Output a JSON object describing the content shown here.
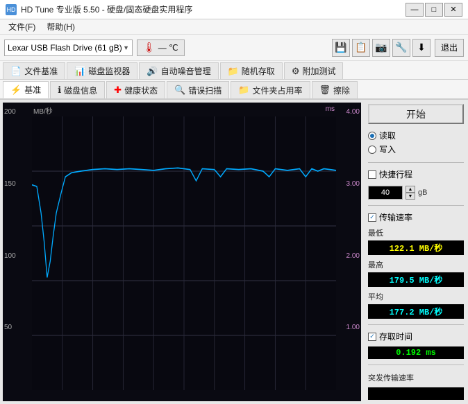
{
  "titlebar": {
    "title": "HD Tune 专业版 5.50 - 硬盘/固态硬盘实用程序",
    "icon_label": "HD",
    "min_btn": "—",
    "max_btn": "□",
    "close_btn": "✕"
  },
  "menubar": {
    "items": [
      {
        "label": "文件(F)",
        "underline": "F"
      },
      {
        "label": "帮助(H)",
        "underline": "H"
      }
    ]
  },
  "toolbar": {
    "device_name": "Lexar   USB Flash Drive (61 gB)",
    "temp_label": "— ℃",
    "icons": [
      "💾",
      "📋",
      "📷",
      "🔧",
      "⬇"
    ],
    "exit_label": "退出"
  },
  "tabs_row1": [
    {
      "label": "文件基准",
      "icon": "📄",
      "active": false
    },
    {
      "label": "磁盘监视器",
      "icon": "📊",
      "active": false
    },
    {
      "label": "自动噪音管理",
      "icon": "🔊",
      "active": false
    },
    {
      "label": "随机存取",
      "icon": "📁",
      "active": false
    },
    {
      "label": "附加测试",
      "icon": "⚙",
      "active": false
    }
  ],
  "tabs_row2": [
    {
      "label": "基准",
      "icon": "⚡",
      "active": true
    },
    {
      "label": "磁盘信息",
      "icon": "ℹ",
      "active": false
    },
    {
      "label": "健康状态",
      "icon": "➕",
      "active": false
    },
    {
      "label": "错误扫描",
      "icon": "🔍",
      "active": false
    },
    {
      "label": "文件夹占用率",
      "icon": "📁",
      "active": false
    },
    {
      "label": "擦除",
      "icon": "🗑",
      "active": false
    }
  ],
  "chart": {
    "y_axis_left_title": "MB/秒",
    "y_axis_right_title": "ms",
    "y_left_labels": [
      "200",
      "150",
      "100",
      "50"
    ],
    "y_right_labels": [
      "4.00",
      "3.00",
      "2.00",
      "1.00"
    ],
    "grid_color": "#2a2a3a",
    "line_color": "#00aaff",
    "bg_color": "#080810"
  },
  "right_panel": {
    "start_btn": "开始",
    "read_label": "读取",
    "write_label": "写入",
    "quick_label": "快捷行程",
    "quick_value": "40",
    "quick_unit": "gB",
    "transfer_label": "传输速率",
    "min_label": "最低",
    "min_value": "122.1 MB/秒",
    "max_label": "最高",
    "max_value": "179.5 MB/秒",
    "avg_label": "平均",
    "avg_value": "177.2 MB/秒",
    "access_label": "存取时间",
    "access_value": "0.192 ms",
    "burst_label": "突发传输速率",
    "burst_value": ""
  }
}
